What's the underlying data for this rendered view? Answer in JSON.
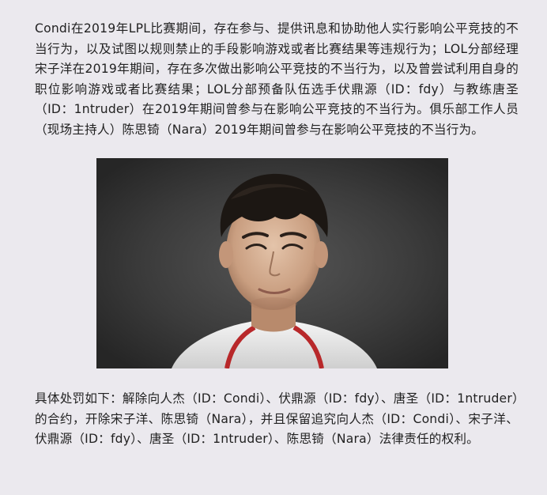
{
  "article": {
    "paragraph_1": "Condi在2019年LPL比赛期间，存在参与、提供讯息和协助他人实行影响公平竞技的不当行为，以及试图以规则禁止的手段影响游戏或者比赛结果等违规行为；LOL分部经理宋子洋在2019年期间，存在多次做出影响公平竞技的不当行为，以及曾尝试利用自身的职位影响游戏或者比赛结果；LOL分部预备队伍选手伏鼎源（ID：fdy）与教练唐圣（ID：1ntruder）在2019年期间曾参与在影响公平竞技的不当行为。俱乐部工作人员（现场主持人）陈思锜（Nara）2019年期间曾参与在影响公平竞技的不当行为。",
    "paragraph_2": "具体处罚如下：解除向人杰（ID：Condi）、伏鼎源（ID：fdy）、唐圣（ID：1ntruder）的合约，开除宋子洋、陈思锜（Nara），并且保留追究向人杰（ID：Condi）、宋子洋、伏鼎源（ID：fdy）、唐圣（ID：1ntruder）、陈思锜（Nara）法律责任的权利。"
  }
}
